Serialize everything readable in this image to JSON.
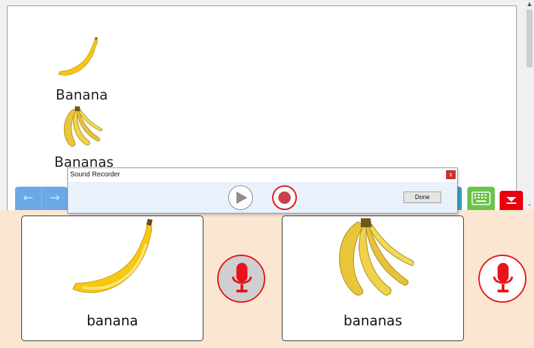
{
  "document": {
    "items": [
      {
        "label": "Banana",
        "image": "banana-icon"
      },
      {
        "label": "Bananas",
        "image": "bananas-bunch-icon"
      }
    ]
  },
  "toolbar": {
    "back_icon": "arrow-left-icon",
    "forward_icon": "arrow-right-icon",
    "keyboard_icon": "keyboard-icon",
    "collapse_icon": "collapse-down-icon"
  },
  "recorder": {
    "title": "Sound Recorder",
    "close_label": "x",
    "play_icon": "play-icon",
    "record_icon": "record-icon",
    "done_label": "Done"
  },
  "cards": [
    {
      "word": "banana",
      "image": "banana-icon",
      "mic_icon": "microphone-icon",
      "mic_state": "active"
    },
    {
      "word": "bananas",
      "image": "bananas-bunch-icon",
      "mic_icon": "microphone-icon",
      "mic_state": "idle"
    }
  ],
  "colors": {
    "accent_red": "#e8141b",
    "nav_blue": "#6ba8e6",
    "keyboard_green": "#6cc24a",
    "panel_background": "#fbe6d2"
  }
}
